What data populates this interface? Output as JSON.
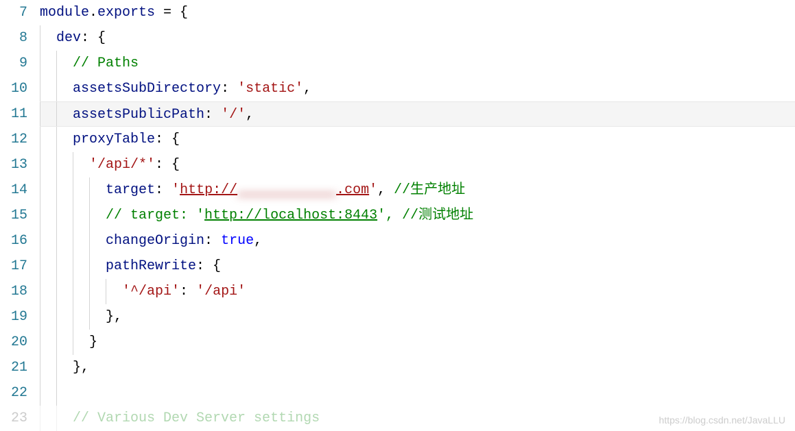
{
  "lines": [
    {
      "num": "7"
    },
    {
      "num": "8"
    },
    {
      "num": "9"
    },
    {
      "num": "10"
    },
    {
      "num": "11"
    },
    {
      "num": "12"
    },
    {
      "num": "13"
    },
    {
      "num": "14"
    },
    {
      "num": "15"
    },
    {
      "num": "16"
    },
    {
      "num": "17"
    },
    {
      "num": "18"
    },
    {
      "num": "19"
    },
    {
      "num": "20"
    },
    {
      "num": "21"
    },
    {
      "num": "22"
    },
    {
      "num": "23"
    }
  ],
  "code": {
    "l7": {
      "t1": "module",
      "t2": ".",
      "t3": "exports",
      "t4": " = {"
    },
    "l8": {
      "t1": "  ",
      "t2": "dev",
      "t3": ": {"
    },
    "l9": {
      "t1": "    ",
      "t2": "// Paths"
    },
    "l10": {
      "t1": "    ",
      "t2": "assetsSubDirectory",
      "t3": ": ",
      "t4": "'static'",
      "t5": ","
    },
    "l11": {
      "t1": "    ",
      "t2": "assetsPublicPath",
      "t3": ": ",
      "t4": "'/'",
      "t5": ","
    },
    "l12": {
      "t1": "    ",
      "t2": "proxyTable",
      "t3": ": {"
    },
    "l13": {
      "t1": "      ",
      "t2": "'/api/*'",
      "t3": ": {"
    },
    "l14": {
      "t1": "        ",
      "t2": "target",
      "t3": ": ",
      "t4": "'",
      "t5": "http://",
      "t6": "            ",
      "t7": ".com",
      "t8": "'",
      "t9": ", ",
      "t10": "//生产地址"
    },
    "l15": {
      "t1": "        ",
      "t2": "// target: '",
      "t3": "http://localhost:8443",
      "t4": "', //测试地址"
    },
    "l16": {
      "t1": "        ",
      "t2": "changeOrigin",
      "t3": ": ",
      "t4": "true",
      "t5": ","
    },
    "l17": {
      "t1": "        ",
      "t2": "pathRewrite",
      "t3": ": {"
    },
    "l18": {
      "t1": "          ",
      "t2": "'^/api'",
      "t3": ": ",
      "t4": "'/api'"
    },
    "l19": {
      "t1": "        },"
    },
    "l20": {
      "t1": "      }"
    },
    "l21": {
      "t1": "    },"
    },
    "l22": {
      "t1": ""
    },
    "l23": {
      "t1": "    ",
      "t2": "// Various Dev Server settings"
    }
  },
  "watermark": "https://blog.csdn.net/JavaLLU"
}
